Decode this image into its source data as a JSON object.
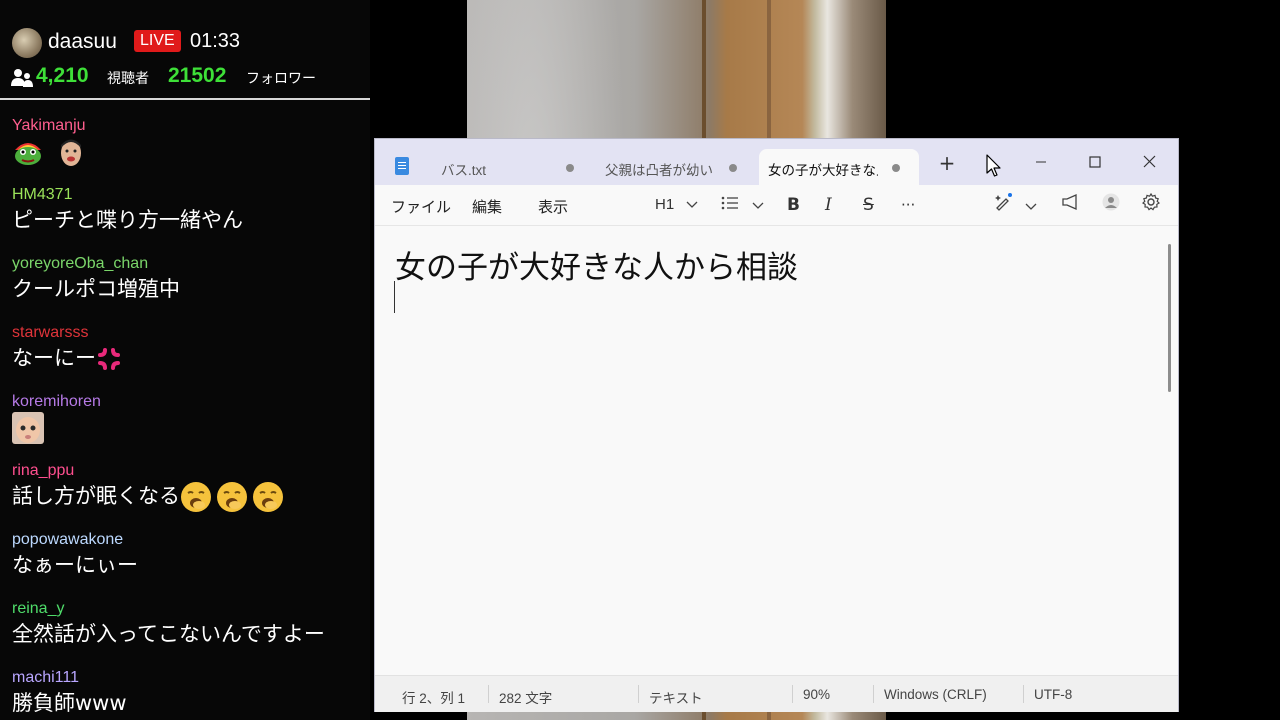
{
  "stream": {
    "streamer": "daasuu",
    "live_label": "LIVE",
    "elapsed": "01:33",
    "viewers": "4,210",
    "viewers_label": "視聴者",
    "followers": "21502",
    "followers_label": "フォロワー"
  },
  "chat": [
    {
      "user": "Yakimanju",
      "user_color": "#ff5f8f",
      "text": "",
      "emotes": [
        "rainbow-frog-emote",
        "face-emote"
      ]
    },
    {
      "user": "HM4371",
      "user_color": "#9be35a",
      "text": "ピーチと喋り方一緒やん",
      "emotes": []
    },
    {
      "user": "yoreyoreOba_chan",
      "user_color": "#7bd66a",
      "text": "クールポコ増殖中",
      "emotes": []
    },
    {
      "user": "starwarsss",
      "user_color": "#e0343a",
      "text": "なーにー",
      "emotes": [
        "anger-symbol-emoji"
      ]
    },
    {
      "user": "koremihoren",
      "user_color": "#b67ae6",
      "text": "",
      "emotes": [
        "baby-face-emote"
      ]
    },
    {
      "user": "rina_ppu",
      "user_color": "#ff4f8f",
      "text": "話し方が眠くなる",
      "emotes": [
        "yawning-face-emoji",
        "yawning-face-emoji",
        "yawning-face-emoji"
      ]
    },
    {
      "user": "popowawakone",
      "user_color": "#bcd9ff",
      "text": "なぁーにぃー",
      "emotes": []
    },
    {
      "user": "reina_y",
      "user_color": "#4fdc6a",
      "text": "全然話が入ってこないんですよー",
      "emotes": []
    },
    {
      "user": "machi111",
      "user_color": "#b9a6ff",
      "text": "勝負師www",
      "emotes": []
    }
  ],
  "notepad": {
    "tabs": [
      {
        "label": "バス.txt",
        "active": false
      },
      {
        "label": "父親は凸者が幼い",
        "active": false
      },
      {
        "label": "女の子が大好きな人",
        "active": true
      }
    ],
    "menu": [
      "ファイル",
      "編集",
      "表示"
    ],
    "toolbar": {
      "heading": "H1",
      "list_icon": "bulleted-list-icon",
      "bold": "B",
      "italic": "I",
      "strike": "S",
      "more": "···"
    },
    "document_heading": "女の子が大好きな人から相談",
    "status": {
      "position": "行 2、列 1",
      "chars": "282 文字",
      "format": "テキスト",
      "zoom": "90%",
      "line_ending": "Windows (CRLF)",
      "encoding": "UTF-8"
    }
  }
}
